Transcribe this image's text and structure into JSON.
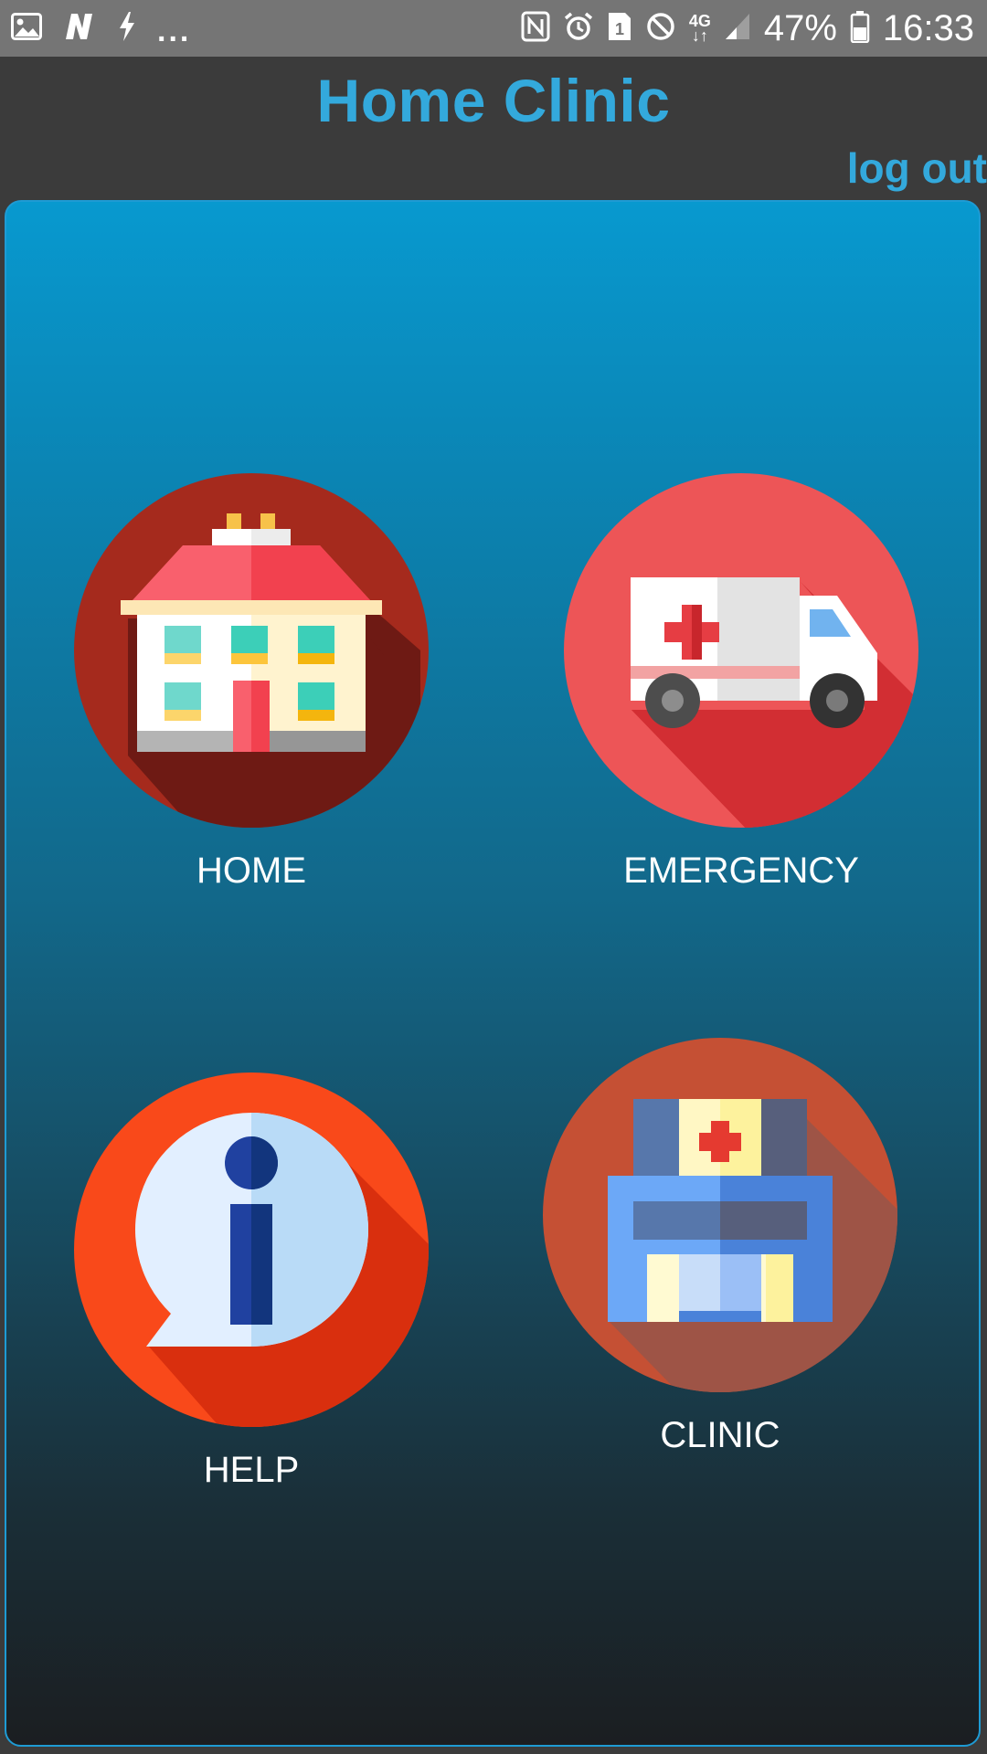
{
  "status_bar": {
    "left_icons": [
      "gallery-icon",
      "n-app-icon",
      "flash-icon"
    ],
    "overflow_dots": "...",
    "right_icons": [
      "nfc-icon",
      "alarm-icon",
      "sim1-icon",
      "blocked-icon",
      "network-4g-icon",
      "signal-icon",
      "battery-icon"
    ],
    "network_label": "4G",
    "sim_label": "1",
    "battery_percent": "47%",
    "time": "16:33"
  },
  "header": {
    "title": "Home Clinic",
    "logout_label": "log out"
  },
  "menu": {
    "items": [
      {
        "label": "HOME",
        "icon": "house-icon"
      },
      {
        "label": "EMERGENCY",
        "icon": "ambulance-icon"
      },
      {
        "label": "HELP",
        "icon": "info-bubble-icon"
      },
      {
        "label": "CLINIC",
        "icon": "hospital-icon"
      }
    ]
  },
  "colors": {
    "accent": "#33a9dc",
    "app_background": "#3b3b3b",
    "status_bar": "#757575",
    "panel_top": "#0899cf",
    "panel_bottom": "#1b1e21"
  }
}
